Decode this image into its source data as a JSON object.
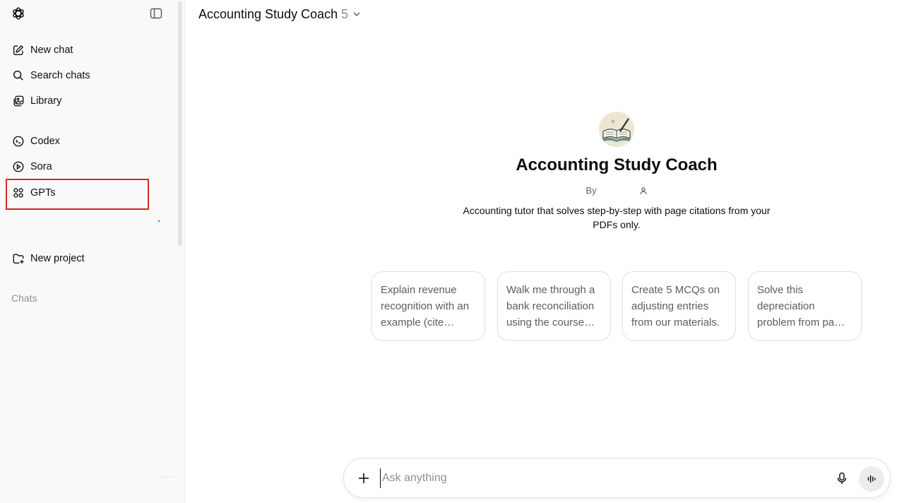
{
  "sidebar": {
    "items": [
      {
        "label": "New chat",
        "icon": "new-chat-icon"
      },
      {
        "label": "Search chats",
        "icon": "search-icon"
      },
      {
        "label": "Library",
        "icon": "library-icon"
      },
      {
        "label": "Codex",
        "icon": "codex-icon"
      },
      {
        "label": "Sora",
        "icon": "play-icon"
      },
      {
        "label": "GPTs",
        "icon": "grid-icon"
      },
      {
        "label": "New project",
        "icon": "folder-plus-icon"
      }
    ],
    "section_label": "Chats",
    "highlight_color": "#d62828"
  },
  "header": {
    "title": "Accounting Study Coach",
    "version": "5"
  },
  "gpt": {
    "name": "Accounting Study Coach",
    "by": "By",
    "description": "Accounting tutor that solves step-by-step with page citations from your PDFs only."
  },
  "suggestions": [
    "Explain revenue recognition with an example (cite…",
    "Walk me through a bank reconciliation using the course…",
    "Create 5 MCQs on adjusting entries from our materials.",
    "Solve this depreciation problem from pa…"
  ],
  "composer": {
    "placeholder": "Ask anything"
  }
}
